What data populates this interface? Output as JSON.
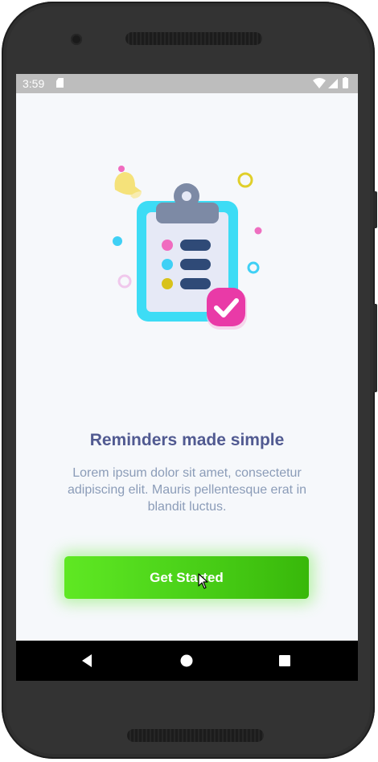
{
  "status_bar": {
    "time": "3:59",
    "icons": [
      "sim-card-icon",
      "wifi-icon",
      "signal-icon",
      "battery-icon"
    ]
  },
  "onboarding": {
    "illustration": "clipboard-checklist-illustration",
    "title": "Reminders made simple",
    "description": "Lorem ipsum dolor sit amet, consectetur adipiscing elit. Mauris pellentesque erat in blandit luctus.",
    "button_label": "Get Started"
  },
  "nav_bar": {
    "icons": [
      "back-icon",
      "home-icon",
      "recents-icon"
    ]
  },
  "colors": {
    "title": "#515a91",
    "description": "#8b9cb8",
    "button_start": "#5fe823",
    "button_end": "#38b80a",
    "screen_bg": "#f6f8fb"
  }
}
